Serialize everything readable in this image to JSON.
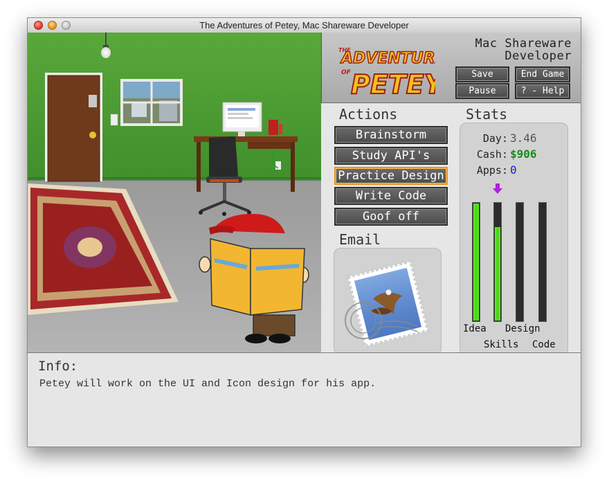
{
  "window": {
    "title": "The Adventures of Petey, Mac Shareware Developer"
  },
  "header": {
    "logo_line1": "THE",
    "logo_line2": "ADVENTURES",
    "logo_line3": "OF",
    "logo_line4": "PETEY",
    "subtitle_line1": "Mac Shareware",
    "subtitle_line2": "Developer",
    "buttons": {
      "save": "Save",
      "end_game": "End Game",
      "pause": "Pause",
      "help": "? - Help"
    }
  },
  "actions": {
    "title": "Actions",
    "items": [
      "Brainstorm",
      "Study API's",
      "Practice Design",
      "Write Code",
      "Goof off"
    ],
    "selected_index": 2
  },
  "email": {
    "title": "Email",
    "icon": "mail-stamp-icon"
  },
  "stats": {
    "title": "Stats",
    "day_label": "Day:",
    "day_value": "3.46",
    "cash_label": "Cash:",
    "cash_value": "$906",
    "apps_label": "Apps:",
    "apps_value": "0",
    "bars": [
      {
        "label": "Idea",
        "level": 1.0
      },
      {
        "label": "Skills",
        "level": 0.8
      },
      {
        "label": "Design",
        "level": 0.0
      },
      {
        "label": "Code",
        "level": 0.0
      }
    ],
    "colors": {
      "cash": "#1a8a1a",
      "apps": "#1a1ad0",
      "day": "#555555",
      "bar_fill": "#3fd80f",
      "indicator": "#b020e0"
    }
  },
  "info": {
    "title": "Info:",
    "text": "Petey will work on the UI and Icon design for his app."
  }
}
